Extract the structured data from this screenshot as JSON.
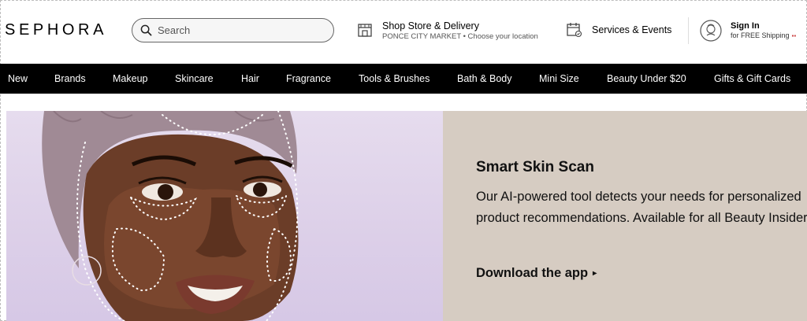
{
  "header": {
    "logo": "SEPHORA",
    "search_placeholder": "Search",
    "store": {
      "title": "Shop Store & Delivery",
      "subtitle": "PONCE CITY MARKET • Choose your location"
    },
    "services_label": "Services & Events",
    "signin": {
      "title": "Sign In",
      "subtitle": "for FREE Shipping"
    }
  },
  "nav": {
    "items": [
      "New",
      "Brands",
      "Makeup",
      "Skincare",
      "Hair",
      "Fragrance",
      "Tools & Brushes",
      "Bath & Body",
      "Mini Size",
      "Beauty Under $20",
      "Gifts & Gift Cards"
    ]
  },
  "hero": {
    "title": "Smart Skin Scan",
    "body": "Our AI-powered tool detects your needs for personalized product recommendations.  Available for all Beauty Insiders.",
    "cta": "Download the app"
  },
  "colors": {
    "nav_bg": "#000000",
    "hero_left_bg": "#dccfe8",
    "hero_right_bg": "#d6ccc2"
  }
}
